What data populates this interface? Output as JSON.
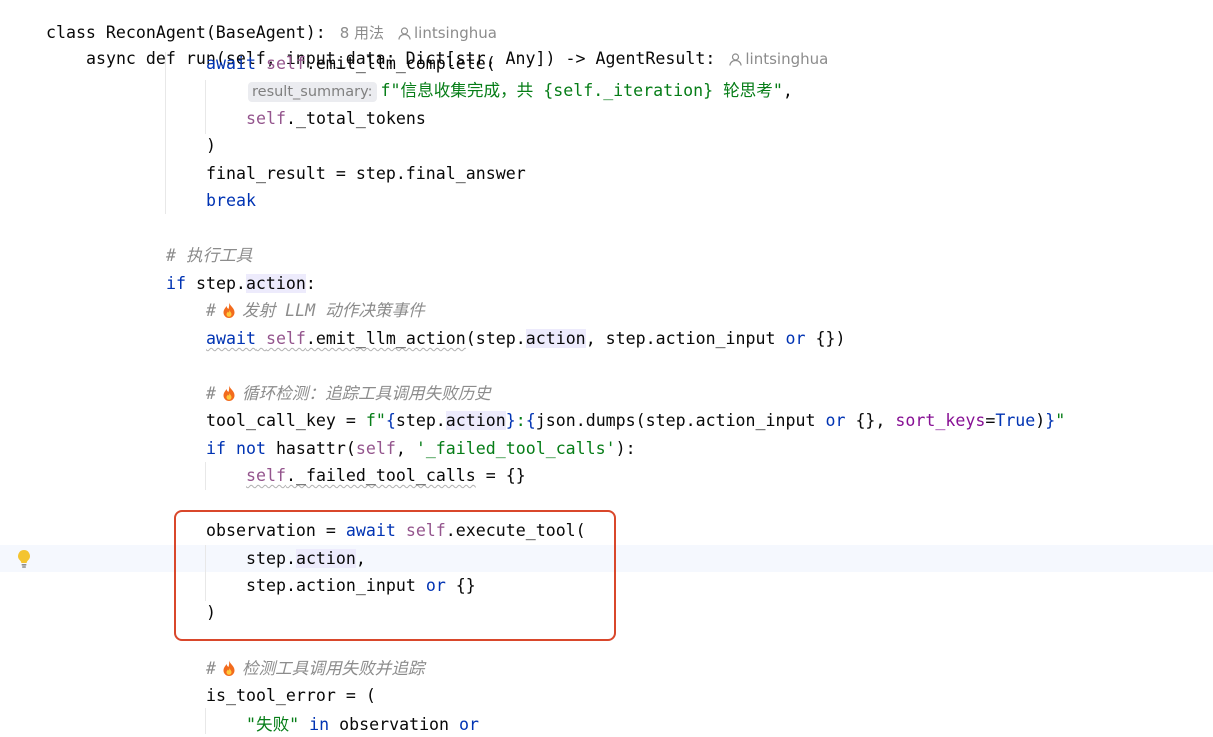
{
  "header": {
    "class_line": "class ReconAgent(BaseAgent):",
    "class_usages": "8 用法",
    "class_author": "lintsinghua",
    "method_line": "async def run(self, input_data: Dict[str, Any]) -> AgentResult:",
    "method_author": "lintsinghua"
  },
  "inlay_hint": "result_summary:",
  "comments": {
    "exec_tool": "# 执行工具",
    "emit_action": "发射 LLM 动作决策事件",
    "loop_detect": "循环检测：追踪工具调用失败历史",
    "detect_fail": "检测工具调用失败并追踪"
  },
  "strings": {
    "summary": "f\"信息收集完成，共 {self._iteration} 轮思考\"",
    "failed_attr": "'_failed_tool_calls'",
    "fail_word": "\"失败\""
  },
  "colors": {
    "keyword": "#0033b3",
    "self": "#94558d",
    "string": "#067d17",
    "comment": "#8c8c8c",
    "box": "#d9472b"
  },
  "icons": [
    "user-icon",
    "fire-icon",
    "lightbulb-icon"
  ]
}
